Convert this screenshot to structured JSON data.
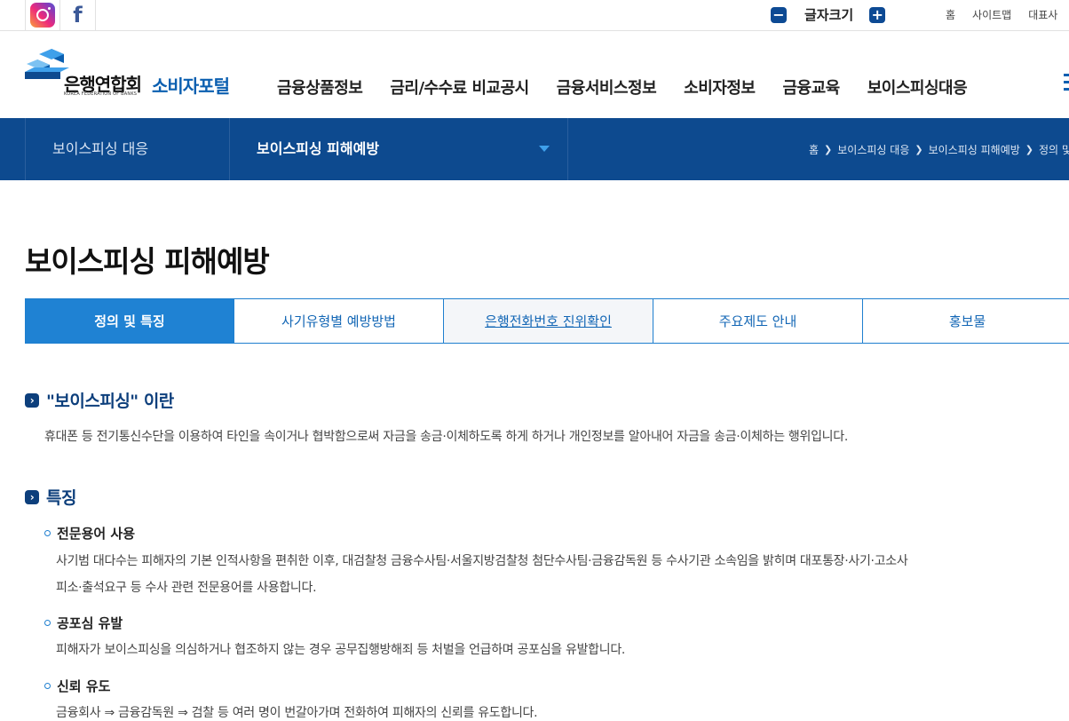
{
  "topbar": {
    "sns": [
      {
        "name": "instagram",
        "icon": "instagram-icon"
      },
      {
        "name": "facebook",
        "icon": "facebook-icon",
        "glyph": "f"
      }
    ],
    "font_size": {
      "minus": "−",
      "label": "글자크기",
      "plus": "+"
    },
    "links": [
      "홈",
      "사이트맵",
      "대표사"
    ]
  },
  "header": {
    "logo": {
      "name": "은행연합회",
      "sub": "KOREA FEDERATION OF BANKS",
      "portal": "소비자포털"
    },
    "gnb": [
      "금융상품정보",
      "금리/수수료 비교공시",
      "금융서비스정보",
      "소비자정보",
      "금융교육",
      "보이스피싱대응"
    ]
  },
  "subnav": {
    "level1": "보이스피싱 대응",
    "level2": "보이스피싱 피해예방",
    "breadcrumb": [
      "홈",
      "보이스피싱 대응",
      "보이스피싱 피해예방",
      "정의 및"
    ]
  },
  "page": {
    "title": "보이스피싱 피해예방",
    "tabs": [
      {
        "label": "정의 및 특징",
        "state": "active"
      },
      {
        "label": "사기유형별 예방방법",
        "state": "normal"
      },
      {
        "label": "은행전화번호 진위확인",
        "state": "hover"
      },
      {
        "label": "주요제도 안내",
        "state": "normal"
      },
      {
        "label": "홍보물",
        "state": "normal"
      }
    ],
    "sections": {
      "definition": {
        "heading": "\"보이스피싱\" 이란",
        "text": "휴대폰 등 전기통신수단을 이용하여 타인을 속이거나 협박함으로써 자금을 송금·이체하도록 하게 하거나 개인정보를 알아내어 자금을 송금·이체하는 행위입니다."
      },
      "features": {
        "heading": "특징",
        "items": [
          {
            "title": "전문용어 사용",
            "lines": [
              "사기범 대다수는 피해자의 기본 인적사항을 편취한 이후, 대검찰청 금융수사팀·서울지방검찰청 첨단수사팀·금융감독원 등 수사기관 소속임을 밝히며 대포통장·사기·고소사",
              "피소·출석요구 등 수사 관련 전문용어를 사용합니다."
            ]
          },
          {
            "title": "공포심 유발",
            "lines": [
              "피해자가 보이스피싱을 의심하거나 협조하지 않는 경우 공무집행방해죄 등 처벌을 언급하며 공포심을 유발합니다."
            ]
          },
          {
            "title": "신뢰 유도",
            "lines": [
              "금융회사 ⇒ 금융감독원 ⇒ 검찰 등 여러 명이 번갈아가며 전화하여 피해자의 신뢰를 유도합니다."
            ]
          }
        ]
      }
    }
  },
  "colors": {
    "navy": "#0d4a8f",
    "tab_active": "#1f82d3",
    "heading": "#0d3f7c",
    "portal_blue": "#0b5fb0"
  }
}
